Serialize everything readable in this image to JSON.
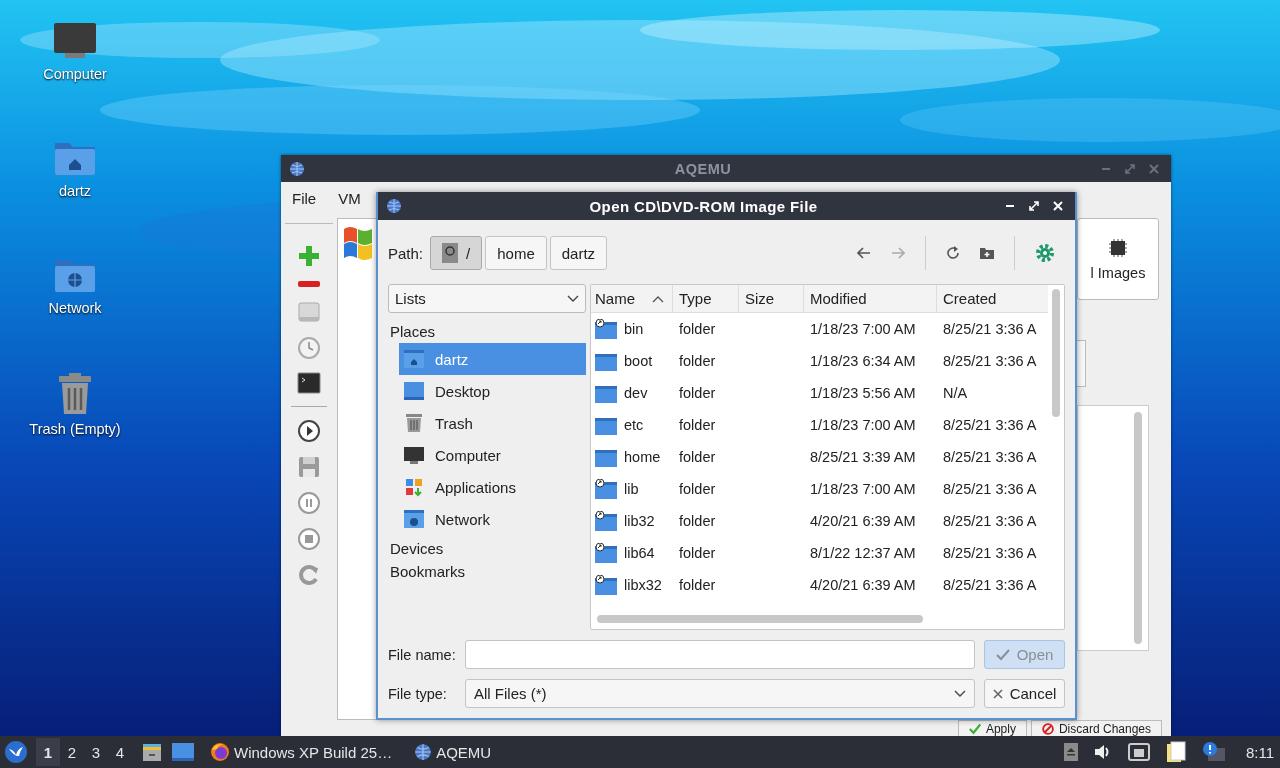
{
  "desktop": {
    "icons": [
      {
        "label": "Computer",
        "kind": "computer"
      },
      {
        "label": "dartz",
        "kind": "home"
      },
      {
        "label": "Network",
        "kind": "network"
      },
      {
        "label": "Trash (Empty)",
        "kind": "trash"
      }
    ]
  },
  "main_window": {
    "title": "AQEMU",
    "menu": [
      "File",
      "VM"
    ],
    "images_button": "l Images",
    "buttons": [
      {
        "label": "Apply",
        "kind": "apply"
      },
      {
        "label": "Discard Changes",
        "kind": "discard"
      }
    ]
  },
  "dialog": {
    "title": "Open CD\\DVD-ROM Image File",
    "path_label": "Path:",
    "path": [
      {
        "label": "/",
        "kind": "root",
        "selected": true
      },
      {
        "label": "home",
        "kind": "dir",
        "selected": false
      },
      {
        "label": "dartz",
        "kind": "dir",
        "selected": false
      }
    ],
    "view_select": "Lists",
    "places_heading": "Places",
    "places": [
      {
        "label": "dartz",
        "kind": "home",
        "selected": true
      },
      {
        "label": "Desktop",
        "kind": "desktop",
        "selected": false
      },
      {
        "label": "Trash",
        "kind": "trash",
        "selected": false
      },
      {
        "label": "Computer",
        "kind": "computer",
        "selected": false
      },
      {
        "label": "Applications",
        "kind": "applications",
        "selected": false
      },
      {
        "label": "Network",
        "kind": "network",
        "selected": false
      }
    ],
    "sections": [
      "Devices",
      "Bookmarks"
    ],
    "columns": [
      {
        "label": "Name",
        "sorted": true
      },
      {
        "label": "Type",
        "sorted": false
      },
      {
        "label": "Size",
        "sorted": false
      },
      {
        "label": "Modified",
        "sorted": false
      },
      {
        "label": "Created",
        "sorted": false
      }
    ],
    "rows": [
      {
        "name": "bin",
        "type": "folder",
        "modified": "1/18/23 7:00 AM",
        "created": "8/25/21 3:36 A",
        "symlink": true
      },
      {
        "name": "boot",
        "type": "folder",
        "modified": "1/18/23 6:34 AM",
        "created": "8/25/21 3:36 A",
        "symlink": false
      },
      {
        "name": "dev",
        "type": "folder",
        "modified": "1/18/23 5:56 AM",
        "created": "N/A",
        "symlink": false
      },
      {
        "name": "etc",
        "type": "folder",
        "modified": "1/18/23 7:00 AM",
        "created": "8/25/21 3:36 A",
        "symlink": false
      },
      {
        "name": "home",
        "type": "folder",
        "modified": "8/25/21 3:39 AM",
        "created": "8/25/21 3:36 A",
        "symlink": false
      },
      {
        "name": "lib",
        "type": "folder",
        "modified": "1/18/23 7:00 AM",
        "created": "8/25/21 3:36 A",
        "symlink": true
      },
      {
        "name": "lib32",
        "type": "folder",
        "modified": "4/20/21 6:39 AM",
        "created": "8/25/21 3:36 A",
        "symlink": true
      },
      {
        "name": "lib64",
        "type": "folder",
        "modified": "8/1/22 12:37 AM",
        "created": "8/25/21 3:36 A",
        "symlink": true
      },
      {
        "name": "libx32",
        "type": "folder",
        "modified": "4/20/21 6:39 AM",
        "created": "8/25/21 3:36 A",
        "symlink": true
      }
    ],
    "file_name_label": "File name:",
    "file_type_label": "File type:",
    "file_type": "All Files (*)",
    "open_button": {
      "label": "Open",
      "disabled": true
    },
    "cancel_button": "Cancel"
  },
  "taskbar": {
    "workspaces": [
      {
        "label": "1",
        "selected": true
      },
      {
        "label": "2",
        "selected": false
      },
      {
        "label": "3",
        "selected": false
      },
      {
        "label": "4",
        "selected": false
      }
    ],
    "tasks": [
      {
        "label": "Windows XP Build 25…",
        "kind": "browser"
      },
      {
        "label": "AQEMU",
        "kind": "aqemu"
      }
    ],
    "clock": "8:11"
  }
}
